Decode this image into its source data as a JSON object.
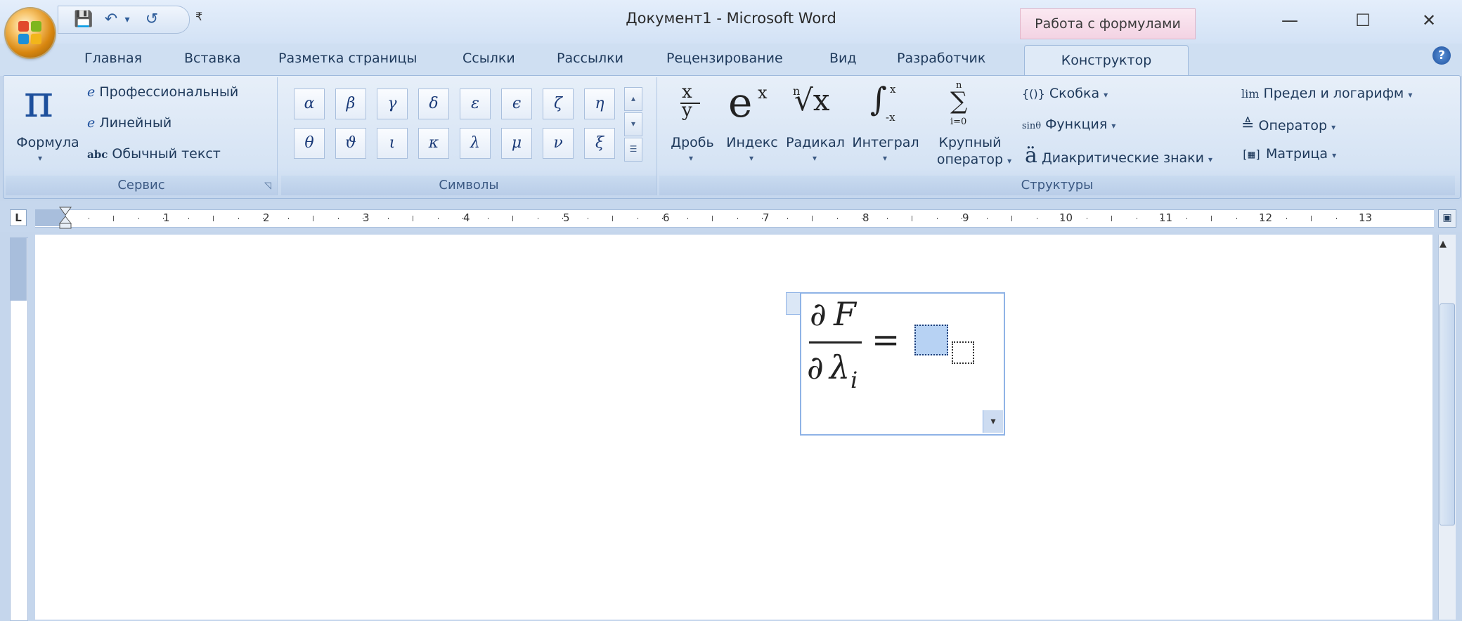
{
  "window": {
    "title": "Документ1 - Microsoft Word",
    "context_tab": "Работа с формулами",
    "minimize_glyph": "—",
    "maximize_glyph": "☐",
    "close_glyph": "✕"
  },
  "quick_access": {
    "save_icon": "💾",
    "undo_icon": "↶",
    "undo_dropdown": "▾",
    "redo_icon": "↺",
    "customize": "₹"
  },
  "tabs": [
    {
      "label": "Главная"
    },
    {
      "label": "Вставка"
    },
    {
      "label": "Разметка страницы"
    },
    {
      "label": "Ссылки"
    },
    {
      "label": "Рассылки"
    },
    {
      "label": "Рецензирование"
    },
    {
      "label": "Вид"
    },
    {
      "label": "Разработчик"
    }
  ],
  "active_tab": "Конструктор",
  "help_glyph": "?",
  "groups": {
    "service": {
      "label": "Сервис",
      "formula_label": "Формула",
      "pi": "π",
      "professional": "Профессиональный",
      "linear": "Линейный",
      "plain_text": "Обычный текст",
      "abc": "abc"
    },
    "symbols": {
      "label": "Символы",
      "row1": [
        "α",
        "β",
        "γ",
        "δ",
        "ε",
        "ϵ",
        "ζ",
        "η"
      ],
      "row2": [
        "θ",
        "ϑ",
        "ι",
        "κ",
        "λ",
        "μ",
        "ν",
        "ξ"
      ]
    },
    "structures": {
      "label": "Структуры",
      "fraction": "Дробь",
      "index": "Индекс",
      "radical": "Радикал",
      "integral": "Интеграл",
      "large_operator_1": "Крупный",
      "large_operator_2": "оператор",
      "bracket": "Скобка",
      "function": "Функция",
      "accent": "Диакритические знаки",
      "limit": "Предел и логарифм",
      "operator": "Оператор",
      "matrix": "Матрица"
    }
  },
  "ruler": {
    "numbers": [
      "1",
      "2",
      "3",
      "4",
      "5",
      "6",
      "7",
      "8",
      "9",
      "10",
      "11",
      "12",
      "13"
    ],
    "corner_glyph": "L"
  },
  "equation": {
    "partial": "∂",
    "numerator_var": "F",
    "denominator_var": "λ",
    "subscript": "i",
    "equals": "="
  }
}
